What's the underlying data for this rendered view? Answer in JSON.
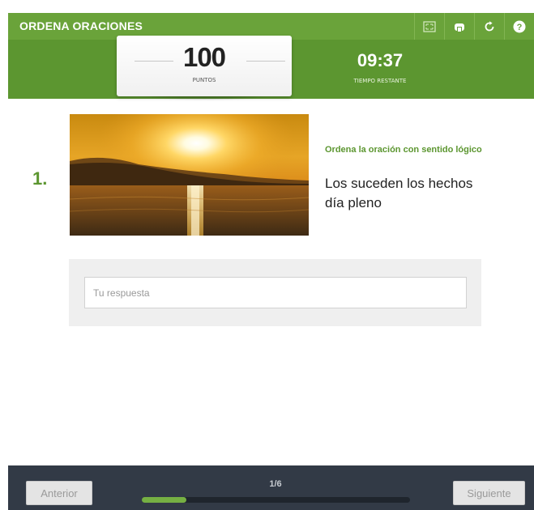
{
  "header": {
    "title": "ORDENA ORACIONES",
    "icons": [
      "fullscreen-icon",
      "print-icon",
      "restart-icon",
      "help-icon"
    ]
  },
  "score": {
    "value": "100",
    "label": "PUNTOS"
  },
  "timer": {
    "value": "09:37",
    "label": "TIEMPO RESTANTE"
  },
  "question": {
    "number": "1.",
    "instruction": "Ordena la oración con sentido lógico",
    "sentence": "Los suceden los hechos día pleno"
  },
  "answer": {
    "placeholder": "Tu respuesta",
    "value": ""
  },
  "footer": {
    "prev_label": "Anterior",
    "next_label": "Siguiente",
    "page": "1/6",
    "progress": 0.1667
  },
  "colors": {
    "accent": "#6aa33a",
    "accent_dark": "#5c9630",
    "footer_bg": "#323a46",
    "progress_fill": "#76b043"
  }
}
